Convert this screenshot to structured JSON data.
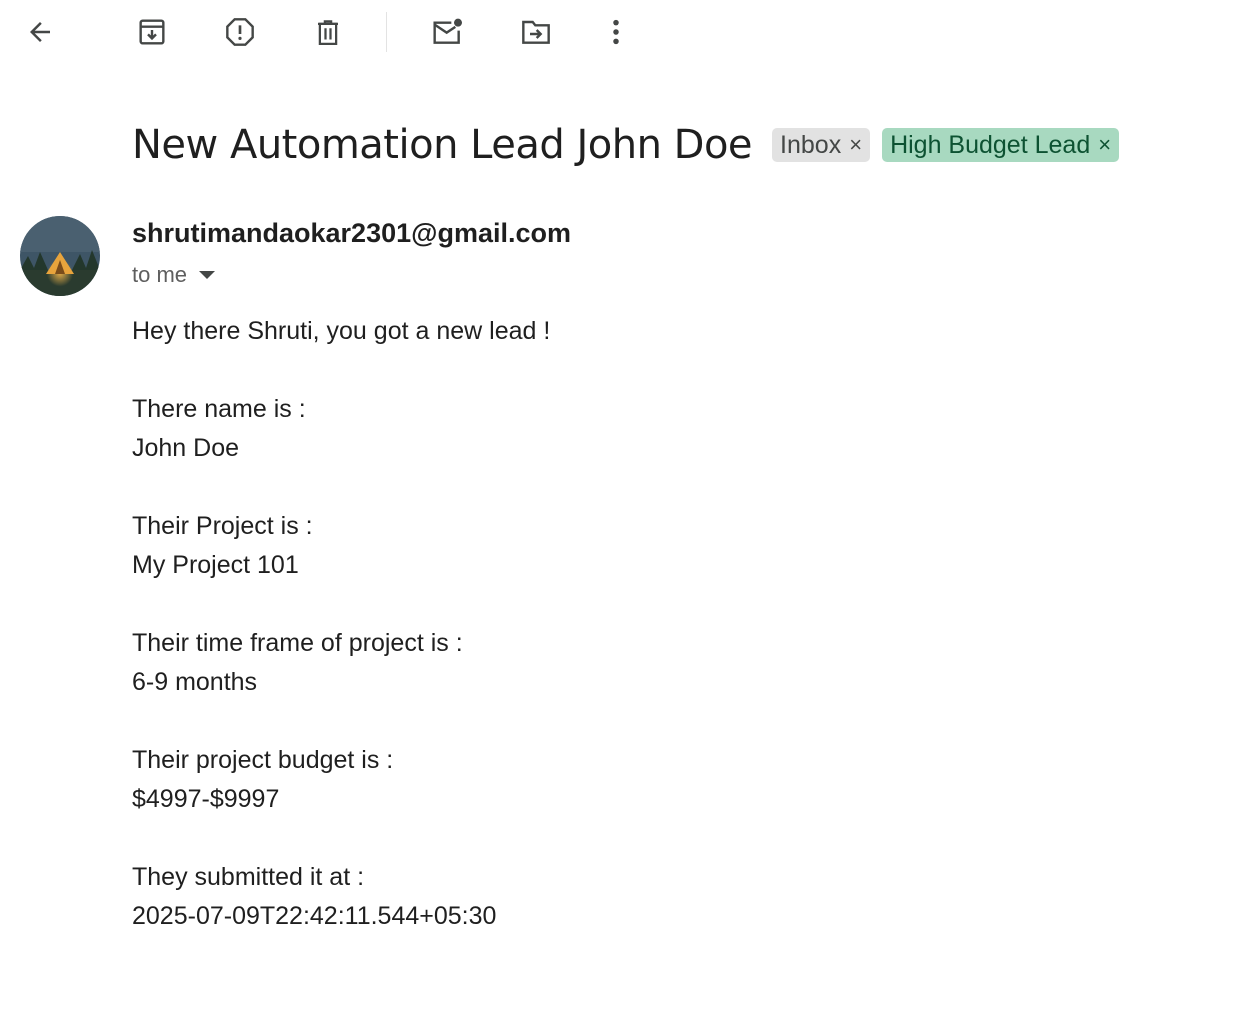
{
  "toolbar": {
    "icons": [
      "back-arrow-icon",
      "archive-icon",
      "report-spam-icon",
      "delete-icon",
      "mark-unread-icon",
      "move-to-icon",
      "more-vert-icon"
    ]
  },
  "email": {
    "subject": "New Automation Lead John Doe",
    "labels": [
      {
        "name": "Inbox",
        "close": "×",
        "bg": "#e2e2e2",
        "fg": "#444746"
      },
      {
        "name": "High Budget Lead",
        "close": "×",
        "bg": "#a8d9c0",
        "fg": "#0d5232"
      }
    ],
    "sender": "shrutimandaokar2301@gmail.com",
    "recipient": "to me",
    "body": {
      "greeting": "Hey there Shruti, you got a new lead !",
      "name_label": "There name is :",
      "name_value": "John Doe",
      "project_label": "Their Project is :",
      "project_value": "My Project 101",
      "timeframe_label": "Their time frame of project is :",
      "timeframe_value": "6-9 months",
      "budget_label": "Their project budget is :",
      "budget_value": "$4997-$9997",
      "submitted_label": "They submitted it at :",
      "submitted_value": "2025-07-09T22:42:11.544+05:30"
    }
  },
  "colors": {
    "icon": "#444746",
    "text": "#1f1f1f",
    "muted": "#5e5e5e"
  }
}
